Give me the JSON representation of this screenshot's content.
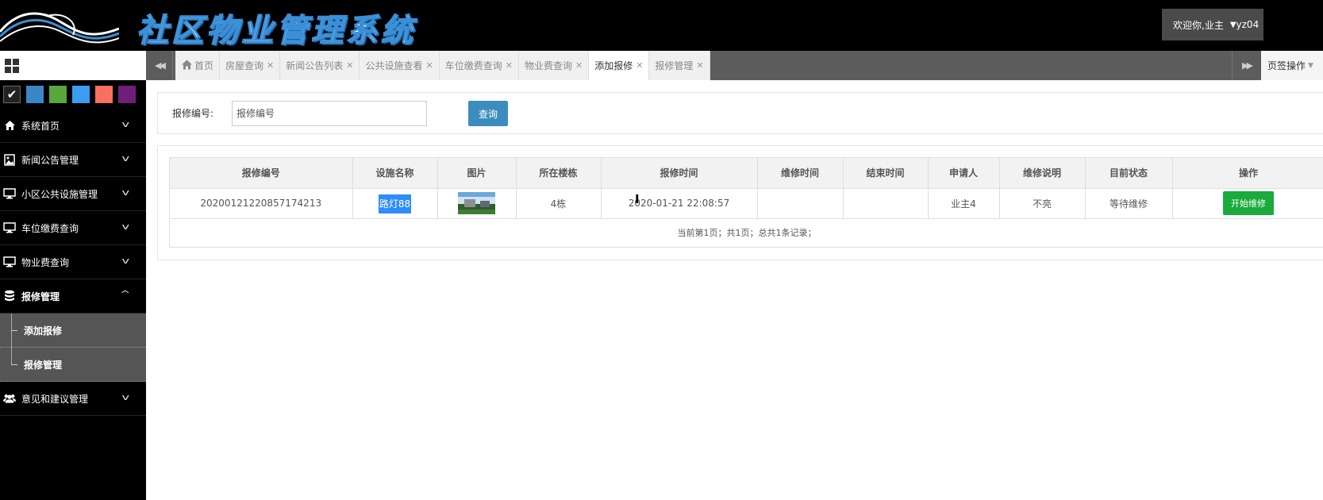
{
  "header": {
    "app_title": "社区物业管理系统",
    "welcome_text": "欢迎你,业主",
    "username": "yz04"
  },
  "sidebar": {
    "theme_colors": [
      "#222222",
      "#3a87c8",
      "#5aa63a",
      "#3b9df0",
      "#fa6f5f",
      "#6f1f7a"
    ],
    "menu": [
      {
        "label": "系统首页",
        "icon": "home-icon"
      },
      {
        "label": "新闻公告管理",
        "icon": "image-icon"
      },
      {
        "label": "小区公共设施管理",
        "icon": "monitor-icon"
      },
      {
        "label": "车位缴费查询",
        "icon": "monitor-icon"
      },
      {
        "label": "物业费查询",
        "icon": "monitor-icon"
      },
      {
        "label": "报修管理",
        "icon": "database-icon"
      },
      {
        "label": "意见和建议管理",
        "icon": "users-icon"
      }
    ],
    "submenu": [
      "添加报修",
      "报修管理"
    ]
  },
  "tabs": [
    {
      "label": "首页"
    },
    {
      "label": "房屋查询"
    },
    {
      "label": "新闻公告列表"
    },
    {
      "label": "公共设施查看"
    },
    {
      "label": "车位缴费查询"
    },
    {
      "label": "物业费查询"
    },
    {
      "label": "添加报修"
    },
    {
      "label": "报修管理"
    }
  ],
  "tab_ops_label": "页签操作",
  "search": {
    "label": "报修编号:",
    "placeholder": "报修编号",
    "button": "查询"
  },
  "table": {
    "headers": [
      "报修编号",
      "设施名称",
      "图片",
      "所在楼栋",
      "报修时间",
      "维修时间",
      "结束时间",
      "申请人",
      "维修说明",
      "目前状态",
      "操作"
    ],
    "rows": [
      {
        "repair_no": "20200121220857174213",
        "facility": "路灯88",
        "building": "4栋",
        "report_time": "2020-01-21 22:08:57",
        "repair_time": "",
        "end_time": "",
        "applicant": "业主4",
        "repair_note": "不亮",
        "status": "等待维修",
        "action": "开始维修"
      }
    ],
    "pagination": "当前第1页；共1页；总共1条记录；"
  }
}
